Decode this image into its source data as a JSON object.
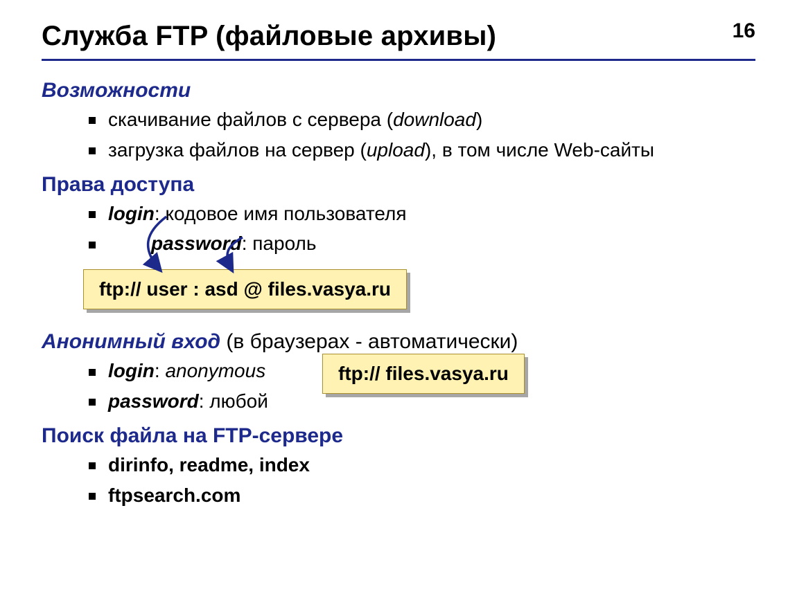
{
  "page_number": "16",
  "title": "Служба FTP (файловые архивы)",
  "sections": {
    "capabilities": {
      "heading": "Возможности",
      "items": [
        {
          "pre": "скачивание файлов c сервера (",
          "term": "download",
          "post": ")"
        },
        {
          "pre": "загрузка файлов на сервер (",
          "term": "upload",
          "post": "), в том числе Web-сайты"
        }
      ]
    },
    "access": {
      "heading": "Права доступа",
      "items": [
        {
          "term": "login",
          "sep": ": ",
          "desc": "кодовое имя пользователя",
          "indent": false
        },
        {
          "term": "password",
          "sep": ": ",
          "desc": "пароль",
          "indent": true
        }
      ],
      "callout": "ftp:// user : asd @ files.vasya.ru"
    },
    "anonymous": {
      "heading_strong": "Анонимный вход",
      "heading_rest": " (в браузерах - автоматически)",
      "items": [
        {
          "term": "login",
          "sep": ": ",
          "desc": "anonymous",
          "desc_italic": true
        },
        {
          "term": "password",
          "sep": ": ",
          "desc": "любой",
          "desc_italic": false
        }
      ],
      "callout": "ftp:// files.vasya.ru"
    },
    "search": {
      "heading": "Поиск файла на FTP-сервере",
      "items": [
        {
          "text": "dirinfo, readme, index"
        },
        {
          "text": "ftpsearch.com"
        }
      ]
    }
  },
  "colors": {
    "accent": "#1d2a8c",
    "callout_bg": "#fff2b2",
    "callout_border": "#a88f2c"
  }
}
